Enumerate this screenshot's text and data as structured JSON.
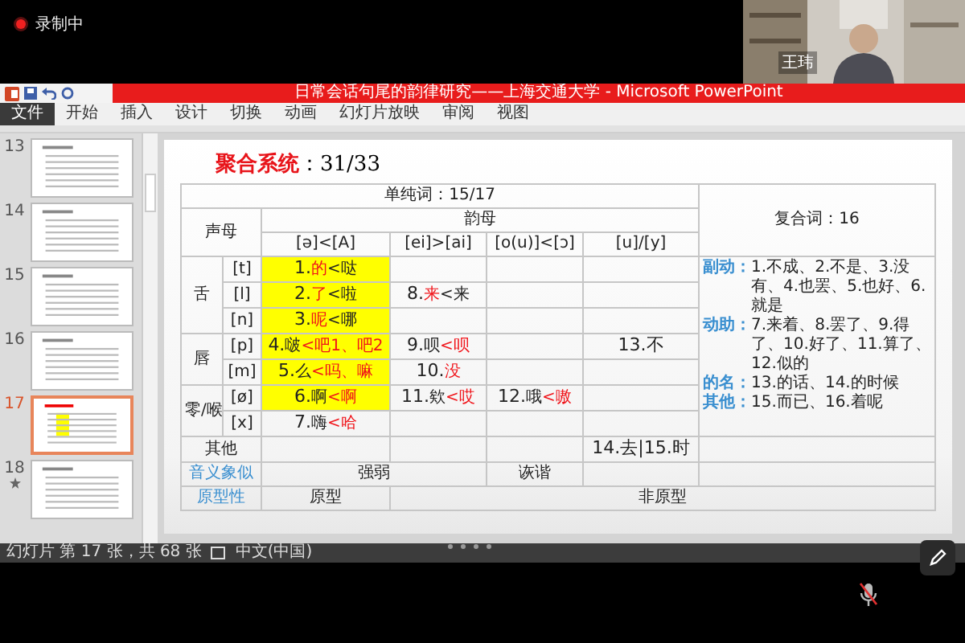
{
  "recording": {
    "label": "录制中"
  },
  "video": {
    "name": "王玮"
  },
  "window": {
    "title": "日常会话句尾的韵律研究——上海交通大学 - Microsoft PowerPoint"
  },
  "ribbon_tabs": [
    {
      "label": "文件",
      "kind": "file"
    },
    {
      "label": "开始",
      "kind": "tab"
    },
    {
      "label": "插入",
      "kind": "tab"
    },
    {
      "label": "设计",
      "kind": "tab"
    },
    {
      "label": "切换",
      "kind": "tab"
    },
    {
      "label": "动画",
      "kind": "tab"
    },
    {
      "label": "幻灯片放映",
      "kind": "tab"
    },
    {
      "label": "审阅",
      "kind": "tab"
    },
    {
      "label": "视图",
      "kind": "tab"
    }
  ],
  "slides": [
    {
      "number": "13",
      "selected": false,
      "starred": false
    },
    {
      "number": "14",
      "selected": false,
      "starred": false
    },
    {
      "number": "15",
      "selected": false,
      "starred": false
    },
    {
      "number": "16",
      "selected": false,
      "starred": false
    },
    {
      "number": "17",
      "selected": true,
      "starred": false
    },
    {
      "number": "18",
      "selected": false,
      "starred": true
    }
  ],
  "slide": {
    "title": {
      "label": "聚合系统",
      "value": "：31/33"
    },
    "table": {
      "simple_header": "单纯词：15/17",
      "compound_header": "复合词：16",
      "initial_header": "声母",
      "final_header": "韵母",
      "finals": [
        "[ə]<[A]",
        "[ei]>[ai]",
        "[o(u)]<[ɔ]",
        "[u]/[y]"
      ],
      "groups": [
        {
          "label": "舌",
          "rows": [
            {
              "consonant": "[t]",
              "cells": [
                {
                  "highlighted": true,
                  "parts": [
                    {
                      "text": "1.",
                      "kind": "plain"
                    },
                    {
                      "text": "的",
                      "kind": "red"
                    },
                    {
                      "text": "<哒",
                      "kind": "note"
                    }
                  ]
                },
                {
                  "highlighted": false
                },
                {
                  "highlighted": false
                },
                {
                  "highlighted": false
                }
              ]
            },
            {
              "consonant": "[l]",
              "cells": [
                {
                  "highlighted": true,
                  "parts": [
                    {
                      "text": "2.",
                      "kind": "plain"
                    },
                    {
                      "text": "了",
                      "kind": "red"
                    },
                    {
                      "text": "<啦",
                      "kind": "note"
                    }
                  ]
                },
                {
                  "highlighted": false,
                  "parts": [
                    {
                      "text": "8.",
                      "kind": "plain"
                    },
                    {
                      "text": "来",
                      "kind": "red"
                    },
                    {
                      "text": "<来",
                      "kind": "note"
                    }
                  ]
                },
                {
                  "highlighted": false
                },
                {
                  "highlighted": false
                }
              ]
            },
            {
              "consonant": "[n]",
              "cells": [
                {
                  "highlighted": true,
                  "parts": [
                    {
                      "text": "3.",
                      "kind": "plain"
                    },
                    {
                      "text": "呢",
                      "kind": "red"
                    },
                    {
                      "text": "<哪",
                      "kind": "note"
                    }
                  ]
                },
                {
                  "highlighted": false
                },
                {
                  "highlighted": false
                },
                {
                  "highlighted": false
                }
              ]
            }
          ]
        },
        {
          "label": "唇",
          "rows": [
            {
              "consonant": "[p]",
              "cells": [
                {
                  "highlighted": true,
                  "parts": [
                    {
                      "text": "4.",
                      "kind": "plain"
                    },
                    {
                      "text": "啵",
                      "kind": "note"
                    },
                    {
                      "text": "<吧1、吧2",
                      "kind": "red"
                    }
                  ]
                },
                {
                  "highlighted": false,
                  "parts": [
                    {
                      "text": "9.",
                      "kind": "plain"
                    },
                    {
                      "text": "呗",
                      "kind": "note"
                    },
                    {
                      "text": "<呗",
                      "kind": "red"
                    }
                  ]
                },
                {
                  "highlighted": false
                },
                {
                  "highlighted": false,
                  "parts": [
                    {
                      "text": "13.不",
                      "kind": "plain"
                    }
                  ]
                }
              ]
            },
            {
              "consonant": "[m]",
              "cells": [
                {
                  "highlighted": true,
                  "parts": [
                    {
                      "text": "5.",
                      "kind": "plain"
                    },
                    {
                      "text": "么",
                      "kind": "note"
                    },
                    {
                      "text": "<吗、嘛",
                      "kind": "red"
                    }
                  ]
                },
                {
                  "highlighted": false,
                  "parts": [
                    {
                      "text": "10.",
                      "kind": "plain"
                    },
                    {
                      "text": "没",
                      "kind": "red"
                    }
                  ]
                },
                {
                  "highlighted": false
                },
                {
                  "highlighted": false
                }
              ]
            }
          ]
        },
        {
          "label": "零/喉",
          "rows": [
            {
              "consonant": "[ø]",
              "cells": [
                {
                  "highlighted": true,
                  "parts": [
                    {
                      "text": "6.",
                      "kind": "plain"
                    },
                    {
                      "text": "啊",
                      "kind": "note"
                    },
                    {
                      "text": "<啊",
                      "kind": "red"
                    }
                  ]
                },
                {
                  "highlighted": false,
                  "parts": [
                    {
                      "text": "11.",
                      "kind": "plain"
                    },
                    {
                      "text": "欸",
                      "kind": "note"
                    },
                    {
                      "text": "<哎",
                      "kind": "red"
                    }
                  ]
                },
                {
                  "highlighted": false,
                  "parts": [
                    {
                      "text": "12.",
                      "kind": "plain"
                    },
                    {
                      "text": "哦",
                      "kind": "note"
                    },
                    {
                      "text": "<嗷",
                      "kind": "red"
                    }
                  ]
                },
                {
                  "highlighted": false
                }
              ]
            },
            {
              "consonant": "[x]",
              "cells": [
                {
                  "highlighted": false,
                  "parts": [
                    {
                      "text": "7.",
                      "kind": "plain"
                    },
                    {
                      "text": "嗨",
                      "kind": "note"
                    },
                    {
                      "text": "<哈",
                      "kind": "red"
                    }
                  ]
                },
                {
                  "highlighted": false
                },
                {
                  "highlighted": false
                },
                {
                  "highlighted": false
                }
              ]
            }
          ]
        }
      ],
      "compound_items": [
        {
          "category": "副动：",
          "text": "1.不成、2.不是、3.没有、4.也罢、5.也好、6.就是"
        },
        {
          "category": "动助：",
          "text": "7.来着、8.罢了、9.得了、10.好了、11.算了、12.似的"
        },
        {
          "category": "的名：",
          "text": "13.的话、14.的时候"
        },
        {
          "category": "其他：",
          "text": "15.而已、16.着呢"
        }
      ],
      "other_row": {
        "label": "其他",
        "cells": [
          {
            "highlighted": false
          },
          {
            "highlighted": false
          },
          {
            "highlighted": false
          },
          {
            "highlighted": false,
            "parts": [
              {
                "text": "14.去|15.时",
                "kind": "plain"
              }
            ]
          }
        ]
      },
      "iconicity_row": {
        "label": "音义象似",
        "values": [
          "强弱",
          "诙谐"
        ]
      },
      "prototype_row": {
        "label": "原型性",
        "values": [
          "原型",
          "非原型"
        ]
      }
    }
  },
  "status_bar": {
    "slide_info": "幻灯片 第 17 张，共 68 张",
    "language": "中文(中国)"
  }
}
